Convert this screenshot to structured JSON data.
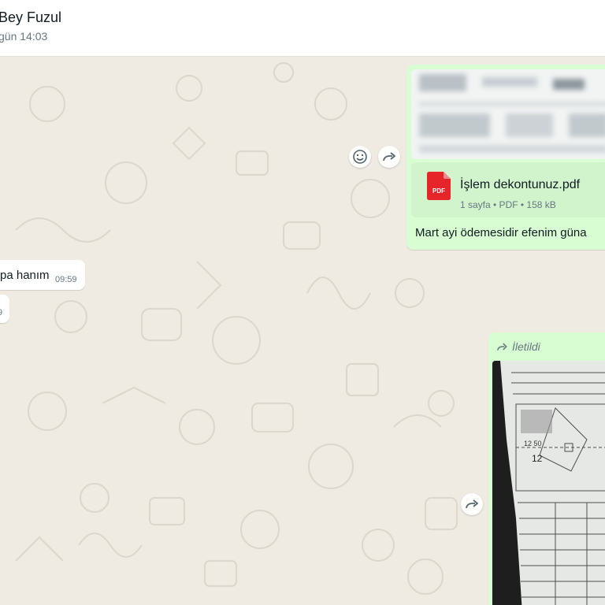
{
  "header": {
    "contact_name": "Bey Fuzul",
    "last_seen": "gün 14:03"
  },
  "messages": {
    "outgoing_pdf": {
      "file_name": "İşlem dekontunuz.pdf",
      "file_meta": "1 sayfa • PDF • 158 kB",
      "file_type_label": "PDF",
      "caption": "Mart ayi ödemesidir efenim güna"
    },
    "incoming_1": {
      "text": "pa hanım",
      "time": "09:59"
    },
    "incoming_2": {
      "time": "9"
    },
    "outgoing_image": {
      "forwarded_label": "İletildi",
      "photo_numbers": {
        "top": "12 50",
        "mid": "12"
      }
    }
  },
  "icons": {
    "react": "emoji-icon",
    "forward": "forward-icon"
  },
  "colors": {
    "chat_background": "#efeae2",
    "outgoing_bubble": "#d9fdd3",
    "pdf_red": "#e53935",
    "muted_text": "#667781"
  }
}
